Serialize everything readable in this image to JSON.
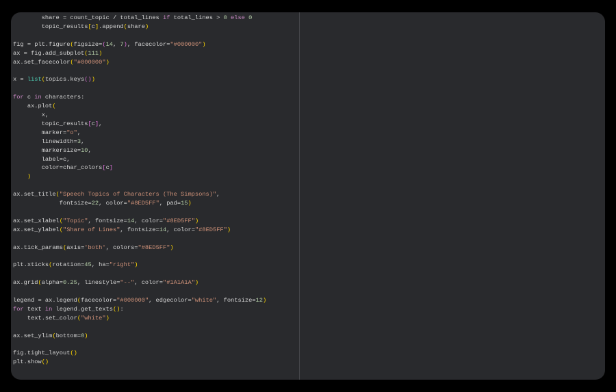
{
  "editor": {
    "lines": [
      [
        [
          "        share = count_topic / total_lines ",
          "d"
        ],
        [
          "if",
          "k"
        ],
        [
          " total_lines > ",
          "d"
        ],
        [
          "0",
          "n"
        ],
        [
          " ",
          "d"
        ],
        [
          "else",
          "k"
        ],
        [
          " ",
          "d"
        ],
        [
          "0",
          "n"
        ]
      ],
      [
        [
          "        topic_results",
          "d"
        ],
        [
          "[",
          "b1"
        ],
        [
          "c",
          "d"
        ],
        [
          "]",
          "b1"
        ],
        [
          ".append",
          "d"
        ],
        [
          "(",
          "b1"
        ],
        [
          "share",
          "d"
        ],
        [
          ")",
          "b1"
        ]
      ],
      [],
      [
        [
          "fig = plt.figure",
          "d"
        ],
        [
          "(",
          "b1"
        ],
        [
          "figsize=",
          "d"
        ],
        [
          "(",
          "b2"
        ],
        [
          "14",
          "n"
        ],
        [
          ", ",
          "d"
        ],
        [
          "7",
          "n"
        ],
        [
          ")",
          "b2"
        ],
        [
          ", facecolor=",
          "d"
        ],
        [
          "\"#000000\"",
          "s"
        ],
        [
          ")",
          "b1"
        ]
      ],
      [
        [
          "ax = fig.add_subplot",
          "d"
        ],
        [
          "(",
          "b1"
        ],
        [
          "111",
          "n"
        ],
        [
          ")",
          "b1"
        ]
      ],
      [
        [
          "ax.set_facecolor",
          "d"
        ],
        [
          "(",
          "b1"
        ],
        [
          "\"#000000\"",
          "s"
        ],
        [
          ")",
          "b1"
        ]
      ],
      [],
      [
        [
          "x = ",
          "d"
        ],
        [
          "list",
          "f"
        ],
        [
          "(",
          "b1"
        ],
        [
          "topics.keys",
          "d"
        ],
        [
          "()",
          "b2"
        ],
        [
          ")",
          "b1"
        ]
      ],
      [],
      [
        [
          "for",
          "k"
        ],
        [
          " c ",
          "d"
        ],
        [
          "in",
          "k"
        ],
        [
          " characters:",
          "d"
        ]
      ],
      [
        [
          "    ax.plot",
          "d"
        ],
        [
          "(",
          "b1"
        ]
      ],
      [
        [
          "        x,",
          "d"
        ]
      ],
      [
        [
          "        topic_results",
          "d"
        ],
        [
          "[",
          "b2"
        ],
        [
          "c",
          "d"
        ],
        [
          "]",
          "b2"
        ],
        [
          ",",
          "d"
        ]
      ],
      [
        [
          "        marker=",
          "d"
        ],
        [
          "\"o\"",
          "s"
        ],
        [
          ",",
          "d"
        ]
      ],
      [
        [
          "        linewidth=",
          "d"
        ],
        [
          "3",
          "n"
        ],
        [
          ",",
          "d"
        ]
      ],
      [
        [
          "        markersize=",
          "d"
        ],
        [
          "10",
          "n"
        ],
        [
          ",",
          "d"
        ]
      ],
      [
        [
          "        label=c,",
          "d"
        ]
      ],
      [
        [
          "        color=char_colors",
          "d"
        ],
        [
          "[",
          "b2"
        ],
        [
          "c",
          "d"
        ],
        [
          "]",
          "b2"
        ]
      ],
      [
        [
          "    ",
          "d"
        ],
        [
          ")",
          "b1"
        ]
      ],
      [],
      [
        [
          "ax.set_title",
          "d"
        ],
        [
          "(",
          "b1"
        ],
        [
          "\"Speech Topics of Characters (The Simpsons)\"",
          "s"
        ],
        [
          ",",
          "d"
        ]
      ],
      [
        [
          "             fontsize=",
          "d"
        ],
        [
          "22",
          "n"
        ],
        [
          ", color=",
          "d"
        ],
        [
          "\"#8ED5FF\"",
          "s"
        ],
        [
          ", pad=",
          "d"
        ],
        [
          "15",
          "n"
        ],
        [
          ")",
          "b1"
        ]
      ],
      [],
      [
        [
          "ax.set_xlabel",
          "d"
        ],
        [
          "(",
          "b1"
        ],
        [
          "\"Topic\"",
          "s"
        ],
        [
          ", fontsize=",
          "d"
        ],
        [
          "14",
          "n"
        ],
        [
          ", color=",
          "d"
        ],
        [
          "\"#8ED5FF\"",
          "s"
        ],
        [
          ")",
          "b1"
        ]
      ],
      [
        [
          "ax.set_ylabel",
          "d"
        ],
        [
          "(",
          "b1"
        ],
        [
          "\"Share of Lines\"",
          "s"
        ],
        [
          ", fontsize=",
          "d"
        ],
        [
          "14",
          "n"
        ],
        [
          ", color=",
          "d"
        ],
        [
          "\"#8ED5FF\"",
          "s"
        ],
        [
          ")",
          "b1"
        ]
      ],
      [],
      [
        [
          "ax.tick_params",
          "d"
        ],
        [
          "(",
          "b1"
        ],
        [
          "axis=",
          "d"
        ],
        [
          "'both'",
          "s"
        ],
        [
          ", colors=",
          "d"
        ],
        [
          "\"#8ED5FF\"",
          "s"
        ],
        [
          ")",
          "b1"
        ]
      ],
      [],
      [
        [
          "plt.xticks",
          "d"
        ],
        [
          "(",
          "b1"
        ],
        [
          "rotation=",
          "d"
        ],
        [
          "45",
          "n"
        ],
        [
          ", ha=",
          "d"
        ],
        [
          "\"right\"",
          "s"
        ],
        [
          ")",
          "b1"
        ]
      ],
      [],
      [
        [
          "ax.grid",
          "d"
        ],
        [
          "(",
          "b1"
        ],
        [
          "alpha=",
          "d"
        ],
        [
          "0.25",
          "n"
        ],
        [
          ", linestyle=",
          "d"
        ],
        [
          "\"--\"",
          "s"
        ],
        [
          ", color=",
          "d"
        ],
        [
          "\"#1A1A1A\"",
          "s"
        ],
        [
          ")",
          "b1"
        ]
      ],
      [],
      [
        [
          "legend = ax.legend",
          "d"
        ],
        [
          "(",
          "b1"
        ],
        [
          "facecolor=",
          "d"
        ],
        [
          "\"#000000\"",
          "s"
        ],
        [
          ", edgecolor=",
          "d"
        ],
        [
          "\"white\"",
          "s"
        ],
        [
          ", fontsize=",
          "d"
        ],
        [
          "12",
          "n"
        ],
        [
          ")",
          "b1"
        ]
      ],
      [
        [
          "for",
          "k"
        ],
        [
          " text ",
          "d"
        ],
        [
          "in",
          "k"
        ],
        [
          " legend.get_texts",
          "d"
        ],
        [
          "()",
          "b1"
        ],
        [
          ":",
          "d"
        ]
      ],
      [
        [
          "    text.set_color",
          "d"
        ],
        [
          "(",
          "b1"
        ],
        [
          "\"white\"",
          "s"
        ],
        [
          ")",
          "b1"
        ]
      ],
      [],
      [
        [
          "ax.set_ylim",
          "d"
        ],
        [
          "(",
          "b1"
        ],
        [
          "bottom=",
          "d"
        ],
        [
          "0",
          "n"
        ],
        [
          ")",
          "b1"
        ]
      ],
      [],
      [
        [
          "fig.tight_layout",
          "d"
        ],
        [
          "()",
          "b1"
        ]
      ],
      [
        [
          "plt.show",
          "d"
        ],
        [
          "()",
          "b1"
        ]
      ]
    ]
  },
  "colors": {
    "background": "#292a2d",
    "text": "#d4d4d4",
    "keyword": "#c586c0",
    "string": "#ce9178",
    "number": "#b5cea8",
    "bracket": "#ffd700"
  }
}
